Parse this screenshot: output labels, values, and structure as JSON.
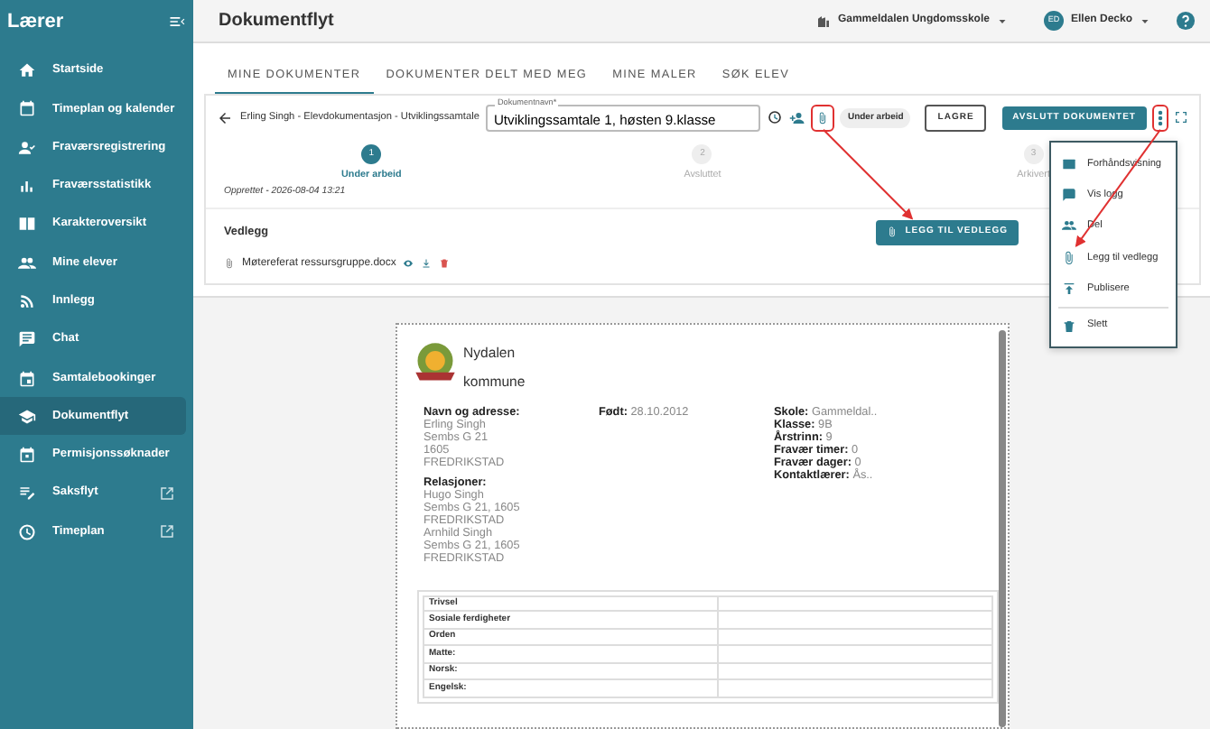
{
  "sidebar": {
    "title": "Lærer",
    "items": [
      {
        "label": "Startside",
        "selected": false,
        "external": false
      },
      {
        "label": "Timeplan og kalender",
        "selected": false,
        "external": false
      },
      {
        "label": "Fraværsregistrering",
        "selected": false,
        "external": false
      },
      {
        "label": "Fraværsstatistikk",
        "selected": false,
        "external": false
      },
      {
        "label": "Karakteroversikt",
        "selected": false,
        "external": false
      },
      {
        "label": "Mine elever",
        "selected": false,
        "external": false
      },
      {
        "label": "Innlegg",
        "selected": false,
        "external": false
      },
      {
        "label": "Chat",
        "selected": false,
        "external": false
      },
      {
        "label": "Samtalebookinger",
        "selected": false,
        "external": false
      },
      {
        "label": "Dokumentflyt",
        "selected": true,
        "external": false
      },
      {
        "label": "Permisjonssøknader",
        "selected": false,
        "external": false
      },
      {
        "label": "Saksflyt",
        "selected": false,
        "external": true
      },
      {
        "label": "Timeplan",
        "selected": false,
        "external": true
      }
    ]
  },
  "header": {
    "title": "Dokumentflyt",
    "school": "Gammeldalen Ungdomsskole",
    "user": {
      "initials": "ED",
      "name": "Ellen Decko"
    }
  },
  "tabs": [
    {
      "label": "MINE DOKUMENTER",
      "selected": true
    },
    {
      "label": "DOKUMENTER DELT MED MEG",
      "selected": false
    },
    {
      "label": "MINE MALER",
      "selected": false
    },
    {
      "label": "SØK ELEV",
      "selected": false
    }
  ],
  "document_toolbar": {
    "breadcrumb": "Erling Singh - Elevdokumentasjon - Utviklingssamtale",
    "name_field": {
      "label": "Dokumentnavn*",
      "value": "Utviklingssamtale 1, høsten 9.klasse"
    },
    "attach_highlighted": true,
    "status": "Under arbeid",
    "save_button": "LAGRE",
    "finish_button": "AVSLUTT DOKUMENTET",
    "menu_highlighted": true
  },
  "stepper": {
    "steps": [
      {
        "number": "1",
        "label": "Under arbeid",
        "selected": true
      },
      {
        "number": "2",
        "label": "Avsluttet",
        "selected": false
      },
      {
        "number": "3",
        "label": "Arkivert",
        "selected": false
      }
    ],
    "created": "Opprettet - 2026-08-04 13:21"
  },
  "attachments": {
    "title": "Vedlegg",
    "add_button": "LEGG TIL VEDLEGG",
    "files": [
      {
        "name": "Møtereferat ressursgruppe.docx"
      }
    ]
  },
  "menu": {
    "items": [
      {
        "label": "Forhåndsvisning",
        "kind": "action"
      },
      {
        "label": "Vis logg",
        "kind": "action"
      },
      {
        "label": "Del",
        "kind": "action"
      },
      {
        "label": "Legg til vedlegg",
        "kind": "action",
        "highlighted": true
      },
      {
        "label": "Publisere",
        "kind": "action"
      },
      {
        "label": "Slett",
        "kind": "delete"
      }
    ]
  },
  "preview": {
    "municipality": [
      "Nydalen",
      "kommune"
    ],
    "columns": [
      {
        "blocks": [
          {
            "label": "Navn og adresse:",
            "lines": [
              "Erling Singh",
              "Sembs G 21",
              "1605",
              "FREDRIKSTAD"
            ],
            "kind": "block"
          },
          {
            "label": "Relasjoner:",
            "lines": [
              "Hugo Singh",
              "Sembs G 21, 1605",
              "FREDRIKSTAD",
              "Arnhild Singh",
              "Sembs G 21, 1605",
              "FREDRIKSTAD"
            ],
            "kind": "block"
          }
        ]
      },
      {
        "blocks": [
          {
            "label": "Født:",
            "lines": [
              "28.10.2012"
            ],
            "kind": "inline"
          }
        ]
      },
      {
        "blocks": [
          {
            "label": "Skole:",
            "lines": [
              "Gammeldal.."
            ],
            "kind": "inline"
          },
          {
            "label": "Klasse:",
            "lines": [
              "9B"
            ],
            "kind": "inline"
          },
          {
            "label": "Årstrinn:",
            "lines": [
              "9"
            ],
            "kind": "inline"
          },
          {
            "label": "Fravær timer:",
            "lines": [
              "0"
            ],
            "kind": "inline"
          },
          {
            "label": "Fravær dager:",
            "lines": [
              "0"
            ],
            "kind": "inline"
          },
          {
            "label": "Kontaktlærer:",
            "lines": [
              "Ås.."
            ],
            "kind": "inline"
          }
        ]
      }
    ],
    "table_rows": [
      "Trivsel",
      "Sosiale ferdigheter",
      "Orden",
      "Matte:",
      "Norsk:",
      "Engelsk:"
    ]
  }
}
